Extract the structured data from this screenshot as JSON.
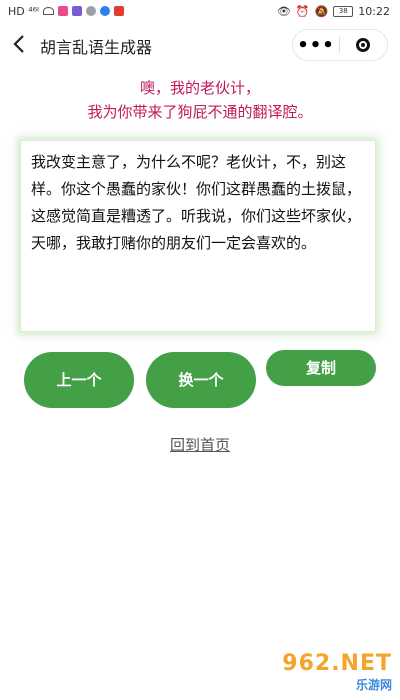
{
  "status_bar": {
    "left_text": "HD ⁴⁶ᴵ",
    "time": "10:22",
    "battery": "38"
  },
  "navbar": {
    "back_icon": "chevron-left-icon",
    "title": "胡言乱语生成器",
    "more_icon": "more-dots-icon",
    "close_icon": "target-close-icon"
  },
  "intro": {
    "line1": "噢，我的老伙计，",
    "line2": "我为你带来了狗屁不通的翻译腔。"
  },
  "output": {
    "text": "我改变主意了，为什么不呢？老伙计，不，别这样。你这个愚蠢的家伙！你们这群愚蠢的土拨鼠，这感觉简直是糟透了。听我说，你们这些坏家伙，天哪，我敢打赌你的朋友们一定会喜欢的。"
  },
  "buttons": {
    "prev_label": "上一个",
    "next_label": "换一个",
    "copy_label": "复制"
  },
  "home_link": "回到首页",
  "watermark": {
    "top": "962.NET",
    "bottom": "乐游网"
  },
  "colors": {
    "accent_green": "#43a047",
    "intro_pink": "#c2185b"
  }
}
